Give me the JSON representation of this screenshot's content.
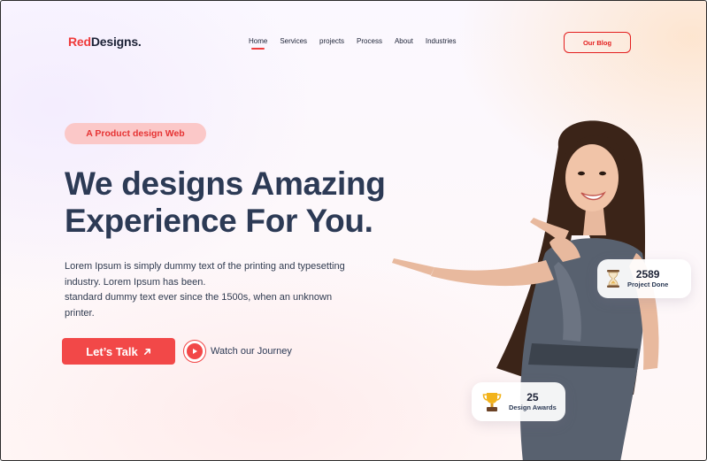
{
  "brand": {
    "logo_red": "Red",
    "logo_rest": "Designs."
  },
  "nav": {
    "items": [
      {
        "label": "Home",
        "active": true
      },
      {
        "label": "Services",
        "active": false
      },
      {
        "label": "projects",
        "active": false
      },
      {
        "label": "Process",
        "active": false
      },
      {
        "label": "About",
        "active": false
      },
      {
        "label": "Industries",
        "active": false
      }
    ],
    "blog_button": "Our Blog"
  },
  "hero": {
    "pill": "A Product design Web",
    "headline_line1": "We designs Amazing",
    "headline_line2": "Experience For You.",
    "desc_line1": "Lorem Ipsum is simply dummy text of the printing and typesetting",
    "desc_line2": "industry. Lorem Ipsum has been.",
    "desc_line3": "standard dummy text ever since the 1500s, when an unknown",
    "desc_line4": "printer.",
    "cta_primary": "Let’s Talk",
    "cta_secondary": "Watch our Journey"
  },
  "stats": {
    "projects": {
      "value": "2589",
      "label": "Project Done",
      "icon": "hourglass-icon"
    },
    "awards": {
      "value": "25",
      "label": "Design Awards",
      "icon": "trophy-icon"
    }
  },
  "colors": {
    "accent": "#f24848",
    "pill_bg": "#fbc8c8",
    "headline": "#2c3a55"
  }
}
